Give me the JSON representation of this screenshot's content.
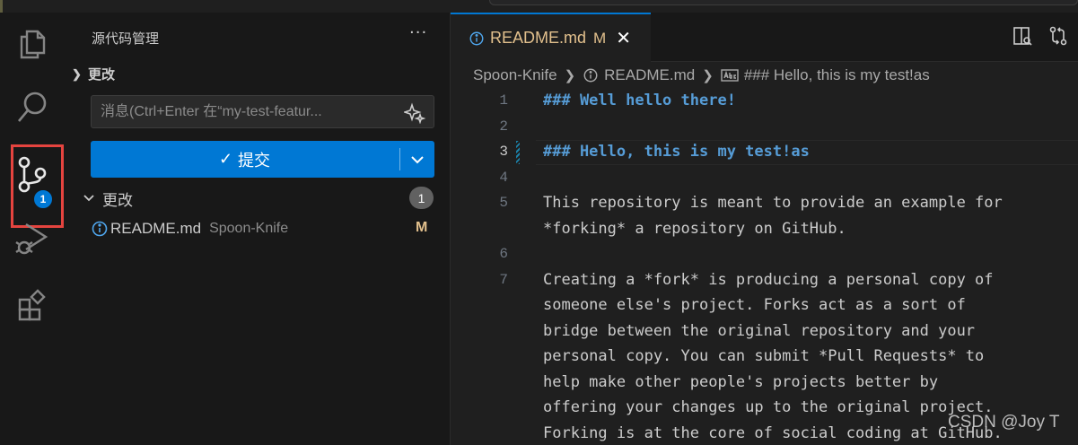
{
  "sidebar": {
    "title": "源代码管理",
    "more": "···",
    "section_title": "更改",
    "message_placeholder": "消息(Ctrl+Enter 在“my-test-featur...",
    "commit_label": "提交",
    "changes_label": "更改",
    "changes_count": "1",
    "files": [
      {
        "name": "README.md",
        "dir": "Spoon-Knife",
        "status": "M"
      }
    ]
  },
  "activity": {
    "scm_badge": "1",
    "icons": [
      "files-icon",
      "search-icon",
      "source-control-icon",
      "run-debug-icon",
      "extensions-icon"
    ]
  },
  "editor": {
    "tab": {
      "name": "README.md",
      "status": "M"
    },
    "breadcrumb": {
      "folder": "Spoon-Knife",
      "file": "README.md",
      "symbol": "### Hello, this is my test!as"
    },
    "lines": [
      {
        "n": "1",
        "text": "### Well hello there!"
      },
      {
        "n": "2",
        "text": ""
      },
      {
        "n": "3",
        "text": "### Hello, this is my test!as"
      },
      {
        "n": "4",
        "text": ""
      },
      {
        "n": "5a",
        "text": "This repository is meant to provide an example for"
      },
      {
        "n": "5b",
        "text": "*forking* a repository on GitHub."
      },
      {
        "n": "6",
        "text": ""
      },
      {
        "n": "7a",
        "text": "Creating a *fork* is producing a personal copy of"
      },
      {
        "n": "7b",
        "text": "someone else's project. Forks act as a sort of"
      },
      {
        "n": "7c",
        "text": "bridge between the original repository and your"
      },
      {
        "n": "7d",
        "text": "personal copy. You can submit *Pull Requests* to"
      },
      {
        "n": "7e",
        "text": "help make other people's projects better by"
      },
      {
        "n": "7f",
        "text": "offering your changes up to the original project."
      },
      {
        "n": "7g",
        "text": "Forking is at the core of social coding at GitHub."
      }
    ],
    "line_numbers": [
      "1",
      "2",
      "3",
      "4",
      "5",
      "6",
      "7"
    ]
  },
  "watermark": "CSDN @Joy T",
  "colors": {
    "accent": "#0078d4",
    "modified": "#e2c08d",
    "heading": "#569cd6",
    "highlight_box": "#e5443f"
  }
}
